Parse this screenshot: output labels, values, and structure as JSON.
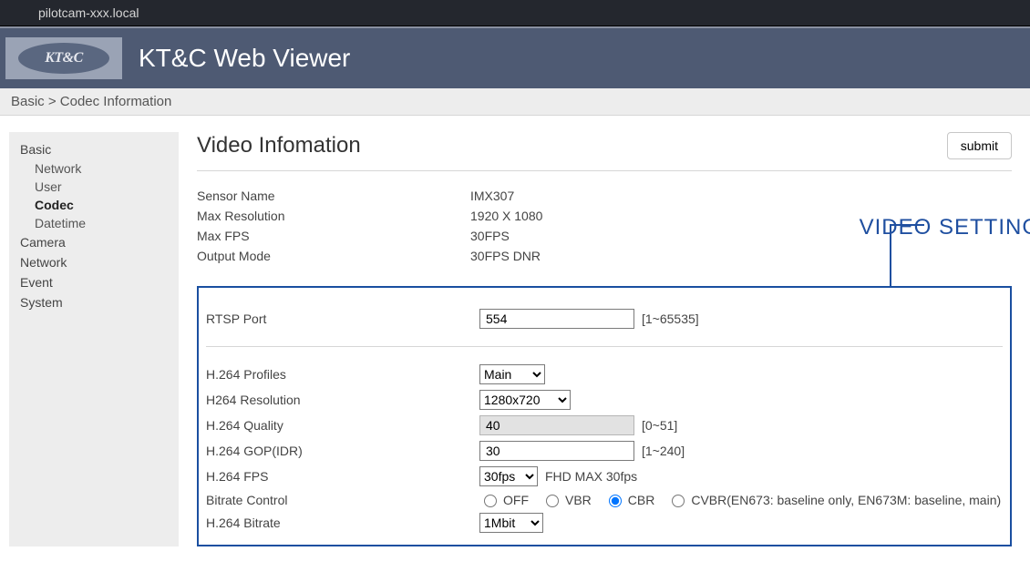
{
  "url_bar": "pilotcam-xxx.local",
  "logo_text": "KT&C",
  "header_title": "KT&C Web Viewer",
  "breadcrumb": "Basic > Codec Information",
  "sidebar": {
    "groups": [
      {
        "label": "Basic",
        "items": [
          {
            "label": "Network",
            "active": false
          },
          {
            "label": "User",
            "active": false
          },
          {
            "label": "Codec",
            "active": true
          },
          {
            "label": "Datetime",
            "active": false
          }
        ]
      },
      {
        "label": "Camera",
        "items": []
      },
      {
        "label": "Network",
        "items": []
      },
      {
        "label": "Event",
        "items": []
      },
      {
        "label": "System",
        "items": []
      }
    ]
  },
  "page_title": "Video Infomation",
  "submit_label": "submit",
  "info": {
    "sensor_name": {
      "label": "Sensor Name",
      "value": "IMX307"
    },
    "max_resolution": {
      "label": "Max Resolution",
      "value": "1920 X 1080"
    },
    "max_fps": {
      "label": "Max FPS",
      "value": "30FPS"
    },
    "output_mode": {
      "label": "Output Mode",
      "value": "30FPS DNR"
    }
  },
  "annotation": "VIDEO SETTINGS",
  "settings": {
    "rtsp_port": {
      "label": "RTSP Port",
      "value": "554",
      "hint": "[1~65535]"
    },
    "h264_profiles": {
      "label": "H.264 Profiles",
      "value": "Main"
    },
    "h264_resolution": {
      "label": "H264 Resolution",
      "value": "1280x720"
    },
    "h264_quality": {
      "label": "H.264 Quality",
      "value": "40",
      "hint": "[0~51]"
    },
    "h264_gop": {
      "label": "H.264 GOP(IDR)",
      "value": "30",
      "hint": "[1~240]"
    },
    "h264_fps": {
      "label": "H.264 FPS",
      "value": "30fps",
      "hint": "FHD MAX 30fps"
    },
    "bitrate_control": {
      "label": "Bitrate Control",
      "options": [
        "OFF",
        "VBR",
        "CBR",
        "CVBR(EN673: baseline only, EN673M: baseline, main)"
      ],
      "selected": "CBR"
    },
    "h264_bitrate": {
      "label": "H.264 Bitrate",
      "value": "1Mbit"
    }
  }
}
